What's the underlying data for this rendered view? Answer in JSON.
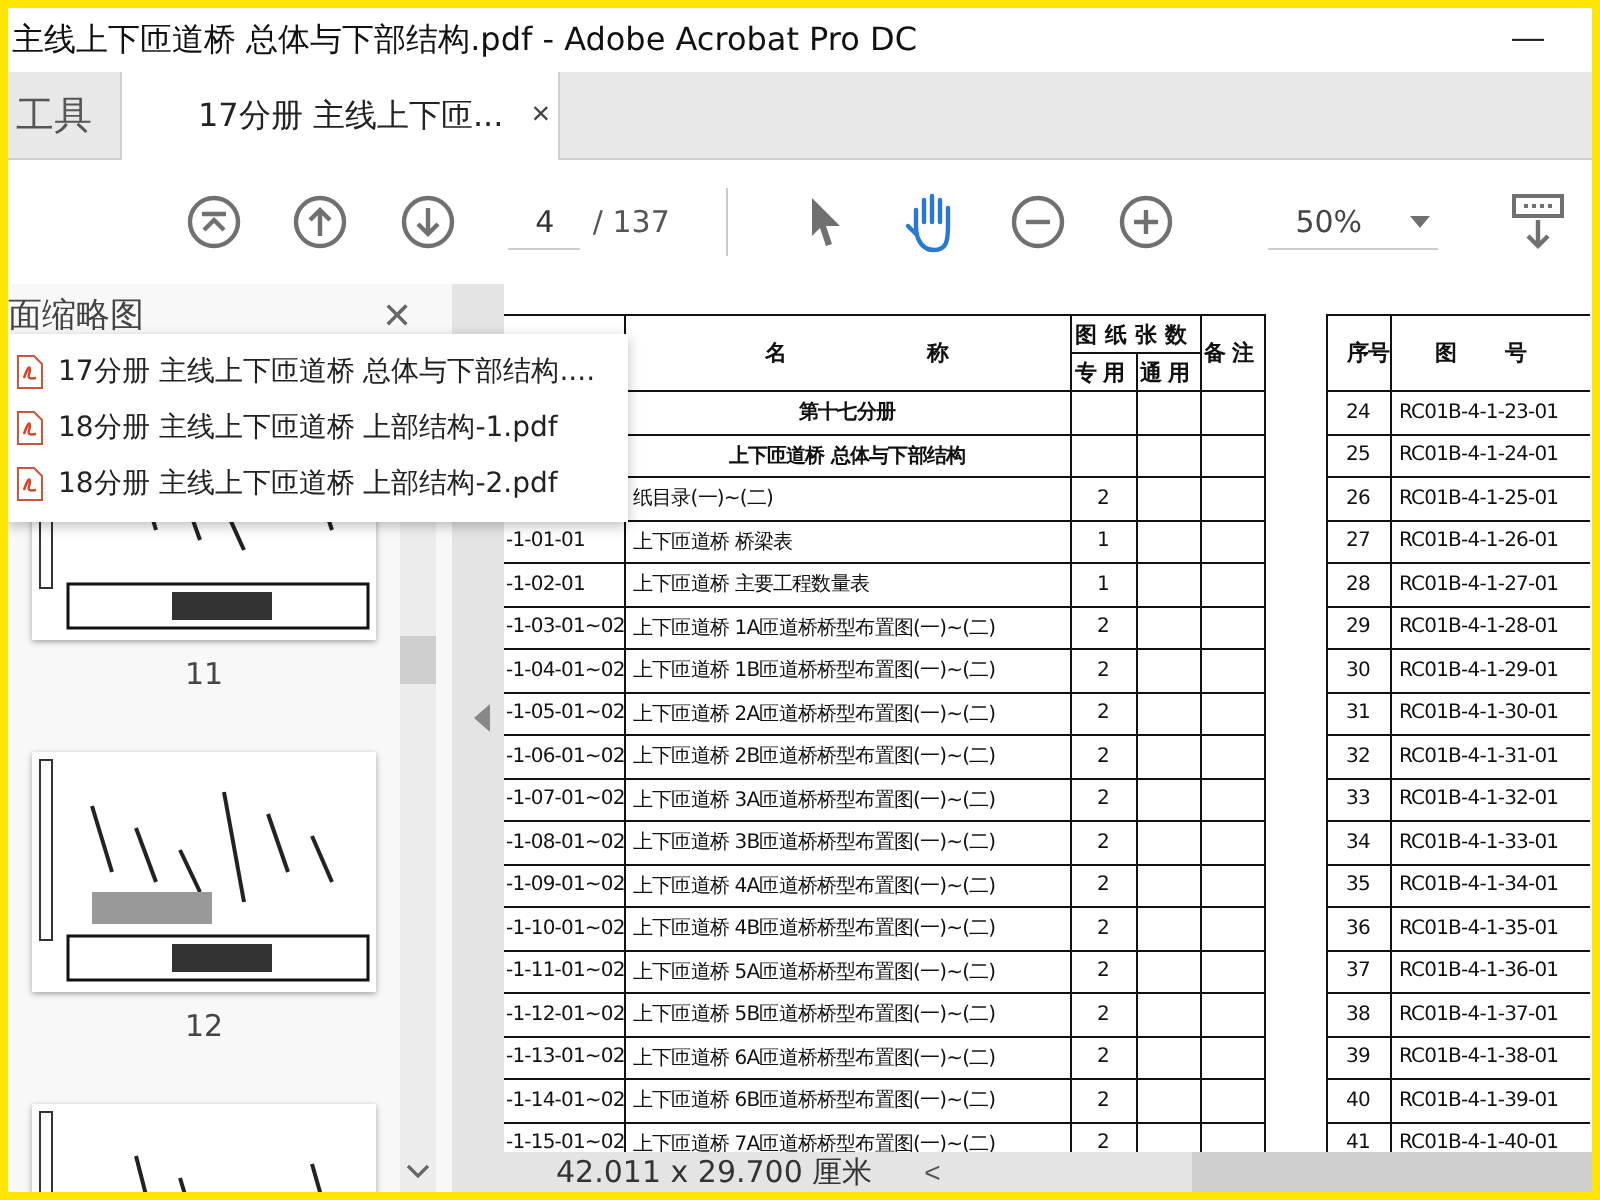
{
  "window": {
    "title": "主线上下匝道桥 总体与下部结构.pdf - Adobe Acrobat Pro DC",
    "minimize": "—"
  },
  "tabs": [
    {
      "label": "工具",
      "selected": false
    },
    {
      "label": "17分册 主线上下匝...",
      "selected": true,
      "close": "×"
    }
  ],
  "toolbar": {
    "page": "4",
    "page_total": "/ 137",
    "zoom": "50%",
    "tools": [
      {
        "kind": "select",
        "selected": false
      },
      {
        "kind": "hand",
        "selected": true
      }
    ]
  },
  "thumbnail_panel": {
    "title": "面缩略图",
    "close": "✕",
    "thumbnails": [
      {
        "label": "11"
      },
      {
        "label": "12"
      },
      {
        "kind": "partial"
      }
    ]
  },
  "recent_files": [
    "17分册 主线上下匝道桥 总体与下部结构....",
    "18分册 主线上下匝道桥 上部结构-1.pdf",
    "18分册 主线上下匝道桥 上部结构-2.pdf"
  ],
  "document": {
    "left_table": {
      "headers": {
        "name": "名称",
        "sheets": "图纸张数",
        "special": "专用",
        "general": "通用",
        "remarks": "备注"
      },
      "rows": [
        {
          "kind": "heading",
          "name": "第十七分册"
        },
        {
          "kind": "heading",
          "name": "上下匝道桥 总体与下部结构"
        },
        {
          "kind": "entry",
          "name": "纸目录(一)~(二)",
          "count": "2"
        },
        {
          "kind": "entry",
          "code": "-1-01-01",
          "name": "上下匝道桥 桥梁表",
          "count": "1"
        },
        {
          "kind": "entry",
          "code": "-1-02-01",
          "name": "上下匝道桥 主要工程数量表",
          "count": "1"
        },
        {
          "kind": "entry",
          "code": "-1-03-01~02",
          "name": "上下匝道桥 1A匝道桥桥型布置图(一)~(二)",
          "count": "2"
        },
        {
          "kind": "entry",
          "code": "-1-04-01~02",
          "name": "上下匝道桥 1B匝道桥桥型布置图(一)~(二)",
          "count": "2"
        },
        {
          "kind": "entry",
          "code": "-1-05-01~02",
          "name": "上下匝道桥 2A匝道桥桥型布置图(一)~(二)",
          "count": "2"
        },
        {
          "kind": "entry",
          "code": "-1-06-01~02",
          "name": "上下匝道桥 2B匝道桥桥型布置图(一)~(二)",
          "count": "2"
        },
        {
          "kind": "entry",
          "code": "-1-07-01~02",
          "name": "上下匝道桥 3A匝道桥桥型布置图(一)~(二)",
          "count": "2"
        },
        {
          "kind": "entry",
          "code": "-1-08-01~02",
          "name": "上下匝道桥 3B匝道桥桥型布置图(一)~(二)",
          "count": "2"
        },
        {
          "kind": "entry",
          "code": "-1-09-01~02",
          "name": "上下匝道桥 4A匝道桥桥型布置图(一)~(二)",
          "count": "2"
        },
        {
          "kind": "entry",
          "code": "-1-10-01~02",
          "name": "上下匝道桥 4B匝道桥桥型布置图(一)~(二)",
          "count": "2"
        },
        {
          "kind": "entry",
          "code": "-1-11-01~02",
          "name": "上下匝道桥 5A匝道桥桥型布置图(一)~(二)",
          "count": "2"
        },
        {
          "kind": "entry",
          "code": "-1-12-01~02",
          "name": "上下匝道桥 5B匝道桥桥型布置图(一)~(二)",
          "count": "2"
        },
        {
          "kind": "entry",
          "code": "-1-13-01~02",
          "name": "上下匝道桥 6A匝道桥桥型布置图(一)~(二)",
          "count": "2"
        },
        {
          "kind": "entry",
          "code": "-1-14-01~02",
          "name": "上下匝道桥 6B匝道桥桥型布置图(一)~(二)",
          "count": "2"
        },
        {
          "kind": "entry",
          "code": "-1-15-01~02",
          "name": "上下匝道桥 7A匝道桥桥型布置图(一)~(二)",
          "count": "2"
        }
      ]
    },
    "right_table": {
      "headers": {
        "number": "序号",
        "drawing_no": "图号"
      },
      "rows": [
        {
          "number": "24",
          "drawing_no": "RC01B-4-1-23-01"
        },
        {
          "number": "25",
          "drawing_no": "RC01B-4-1-24-01"
        },
        {
          "number": "26",
          "drawing_no": "RC01B-4-1-25-01"
        },
        {
          "number": "27",
          "drawing_no": "RC01B-4-1-26-01"
        },
        {
          "number": "28",
          "drawing_no": "RC01B-4-1-27-01"
        },
        {
          "number": "29",
          "drawing_no": "RC01B-4-1-28-01"
        },
        {
          "number": "30",
          "drawing_no": "RC01B-4-1-29-01"
        },
        {
          "number": "31",
          "drawing_no": "RC01B-4-1-30-01"
        },
        {
          "number": "32",
          "drawing_no": "RC01B-4-1-31-01"
        },
        {
          "number": "33",
          "drawing_no": "RC01B-4-1-32-01"
        },
        {
          "number": "34",
          "drawing_no": "RC01B-4-1-33-01"
        },
        {
          "number": "35",
          "drawing_no": "RC01B-4-1-34-01"
        },
        {
          "number": "36",
          "drawing_no": "RC01B-4-1-35-01"
        },
        {
          "number": "37",
          "drawing_no": "RC01B-4-1-36-01"
        },
        {
          "number": "38",
          "drawing_no": "RC01B-4-1-37-01"
        },
        {
          "number": "39",
          "drawing_no": "RC01B-4-1-38-01"
        },
        {
          "number": "40",
          "drawing_no": "RC01B-4-1-39-01"
        },
        {
          "number": "41",
          "drawing_no": "RC01B-4-1-40-01"
        }
      ]
    }
  },
  "status_bar": {
    "page_size": "42.011 x 29.700 厘米",
    "scroll_left": "<"
  }
}
